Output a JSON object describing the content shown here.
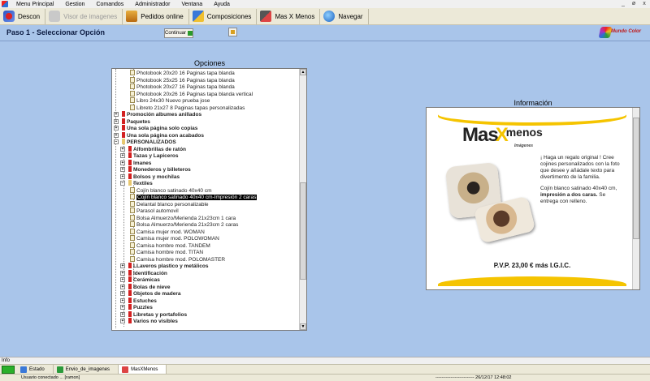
{
  "menu": [
    "Menu Principal",
    "Gestion",
    "Comandos",
    "Administrador",
    "Ventana",
    "Ayuda"
  ],
  "window_controls": [
    "_",
    "ø",
    "x"
  ],
  "toolbar": [
    {
      "label": "Descon",
      "icon": "disconnect-icon",
      "disabled": false
    },
    {
      "label": "Visor de imagenes",
      "icon": "image-viewer-icon",
      "disabled": true
    },
    {
      "label": "Pedidos online",
      "icon": "cart-icon",
      "disabled": false
    },
    {
      "label": "Composiciones",
      "icon": "compose-icon",
      "disabled": false
    },
    {
      "label": "Mas X Menos",
      "icon": "masxmenos-icon",
      "disabled": false
    },
    {
      "label": "Navegar",
      "icon": "globe-icon",
      "disabled": false
    }
  ],
  "step": {
    "title": "Paso 1 - Seleccionar Opción",
    "continue_label": "Continuar",
    "brand": "Mundo Color"
  },
  "options": {
    "title": "Opciones",
    "rows": [
      {
        "label": "Photobook 20x20 16 Paginas tapa blanda",
        "level": 3,
        "type": "doc"
      },
      {
        "label": "Photobook 25x25 16 Paginas tapa blanda",
        "level": 3,
        "type": "doc"
      },
      {
        "label": "Photobook 20x27 16 Paginas tapa blanda",
        "level": 3,
        "type": "doc"
      },
      {
        "label": "Photobook 20x26 16 Paginas tapa blanda vertical",
        "level": 3,
        "type": "doc"
      },
      {
        "label": "Libro 24x30 Nuevo prueba jose",
        "level": 3,
        "type": "doc"
      },
      {
        "label": "Libreto 21x27 8 Paginas tapas personalizadas",
        "level": 3,
        "type": "doc"
      },
      {
        "label": "Promoción albumes anillados",
        "level": 1,
        "type": "cat"
      },
      {
        "label": "Paquetes",
        "level": 1,
        "type": "cat"
      },
      {
        "label": "Una sola página solo copias",
        "level": 1,
        "type": "cat"
      },
      {
        "label": "Una sola página con acabados",
        "level": 1,
        "type": "cat"
      },
      {
        "label": "PERSONALIZADOS",
        "level": 1,
        "type": "open"
      },
      {
        "label": "Alfombrillas de ratón",
        "level": 2,
        "type": "cat"
      },
      {
        "label": "Tazas y Lapiceros",
        "level": 2,
        "type": "cat"
      },
      {
        "label": "Imanes",
        "level": 2,
        "type": "cat"
      },
      {
        "label": "Monederos y billeteros",
        "level": 2,
        "type": "cat"
      },
      {
        "label": "Bolsos y mochilas",
        "level": 2,
        "type": "cat"
      },
      {
        "label": "Textiles",
        "level": 2,
        "type": "open"
      },
      {
        "label": "Cojín blanco satinado 40x40 cm",
        "level": 3,
        "type": "doc"
      },
      {
        "label": "Cojín blanco satinado 40x40 cm-Impresión 2 caras",
        "level": 3,
        "type": "doc",
        "selected": true
      },
      {
        "label": "Delantal blanco personalizable",
        "level": 3,
        "type": "doc"
      },
      {
        "label": "Parasol automovil",
        "level": 3,
        "type": "doc"
      },
      {
        "label": "Bolsa Almuerzo/Merienda 21x23cm 1 cara",
        "level": 3,
        "type": "doc"
      },
      {
        "label": "Bolsa Almuerzo/Merienda 21x23cm 2 caras",
        "level": 3,
        "type": "doc"
      },
      {
        "label": "Camisa mujer mod. WOMAN",
        "level": 3,
        "type": "doc"
      },
      {
        "label": "Camisa mujer mod. POLOWOMAN",
        "level": 3,
        "type": "doc"
      },
      {
        "label": "Camisa hombre mod. TANDEM",
        "level": 3,
        "type": "doc"
      },
      {
        "label": "Camisa hombre mod. TITAN",
        "level": 3,
        "type": "doc"
      },
      {
        "label": "Camisa hombre mod. POLOMASTER",
        "level": 3,
        "type": "doc"
      },
      {
        "label": "LLaveros plastico y metálicos",
        "level": 2,
        "type": "cat"
      },
      {
        "label": "Identificación",
        "level": 2,
        "type": "cat"
      },
      {
        "label": "Cerámicas",
        "level": 2,
        "type": "cat"
      },
      {
        "label": "Bolas de nieve",
        "level": 2,
        "type": "cat"
      },
      {
        "label": "Objetos de madera",
        "level": 2,
        "type": "cat"
      },
      {
        "label": "Estuches",
        "level": 2,
        "type": "cat"
      },
      {
        "label": "Puzzles",
        "level": 2,
        "type": "cat"
      },
      {
        "label": "Libretas y portafolios",
        "level": 2,
        "type": "cat"
      },
      {
        "label": "Varios no visibles",
        "level": 2,
        "type": "cat"
      }
    ]
  },
  "info": {
    "title": "Información",
    "logo_mas": "Mas",
    "logo_x": "X",
    "logo_menos": "menos",
    "logo_sub": "Imágenes",
    "paragraph1": "¡ Haga un regalo original ! Cree cojines personalizados con la foto que desee y añádale texto para divertimento de la familia.",
    "paragraph2_a": "Cojín blanco satinado 40x40 cm,",
    "paragraph2_b": "impresión a dos caras.",
    "paragraph2_c": "Se entrega con relleno.",
    "price": "P.V.P. 23,00 € más I.G.I.C."
  },
  "bottom": {
    "info_label": "Info",
    "tasks": [
      {
        "label": "Estado",
        "icon": "status-icon"
      },
      {
        "label": "Envio_de_imagenes",
        "icon": "upload-icon"
      },
      {
        "label": "MasXMenos",
        "icon": "masxmenos-icon",
        "active": true
      }
    ],
    "user": "Usuario conectado ... [ramon]",
    "datetime": "-------------------------- 26/12/17 12:48:02"
  },
  "colors": {
    "background": "#a9c5ea",
    "accent_yellow": "#f5c400",
    "category_flag": "#d32020"
  }
}
